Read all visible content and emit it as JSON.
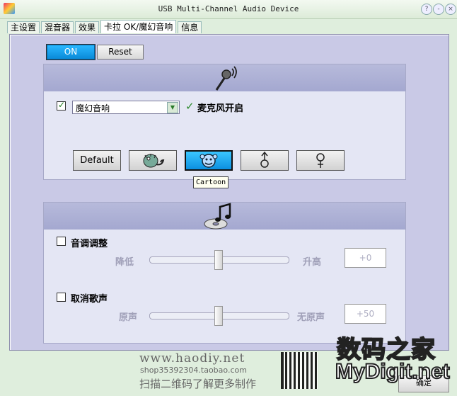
{
  "window": {
    "title": "USB Multi-Channel Audio Device"
  },
  "tabs": [
    {
      "label": "主设置"
    },
    {
      "label": "混音器"
    },
    {
      "label": "效果"
    },
    {
      "label": "卡拉 OK/魔幻音响",
      "active": true
    },
    {
      "label": "信息"
    }
  ],
  "toggles": {
    "on_label": "ON",
    "reset_label": "Reset"
  },
  "magic": {
    "enabled": true,
    "select_value": "魔幻音响",
    "mic_status": "麦克风开启",
    "effects": [
      {
        "label": "Default",
        "icon": "default"
      },
      {
        "label": "",
        "icon": "monster-icon"
      },
      {
        "label": "",
        "icon": "cartoon-icon",
        "active": true
      },
      {
        "label": "",
        "icon": "male-icon"
      },
      {
        "label": "",
        "icon": "female-icon"
      }
    ],
    "tooltip": "Cartoon"
  },
  "pitch": {
    "label": "音调调整",
    "enabled": false,
    "low_label": "降低",
    "high_label": "升高",
    "value": "+0",
    "slider_fraction": 0.5
  },
  "vocal": {
    "label": "取消歌声",
    "enabled": false,
    "low_label": "原声",
    "high_label": "无原声",
    "value": "+50",
    "slider_fraction": 0.5
  },
  "watermark": {
    "site": "www.haodiy.net",
    "shop": "shop35392304.taobao.com",
    "scan": "扫描二维码了解更多制作",
    "brand_cn": "数码之家",
    "brand_en": "MyDigit.net"
  },
  "ok_label": "确定",
  "colors": {
    "active_blue": "#0a8ad8",
    "frame": "#c9c9e6"
  }
}
